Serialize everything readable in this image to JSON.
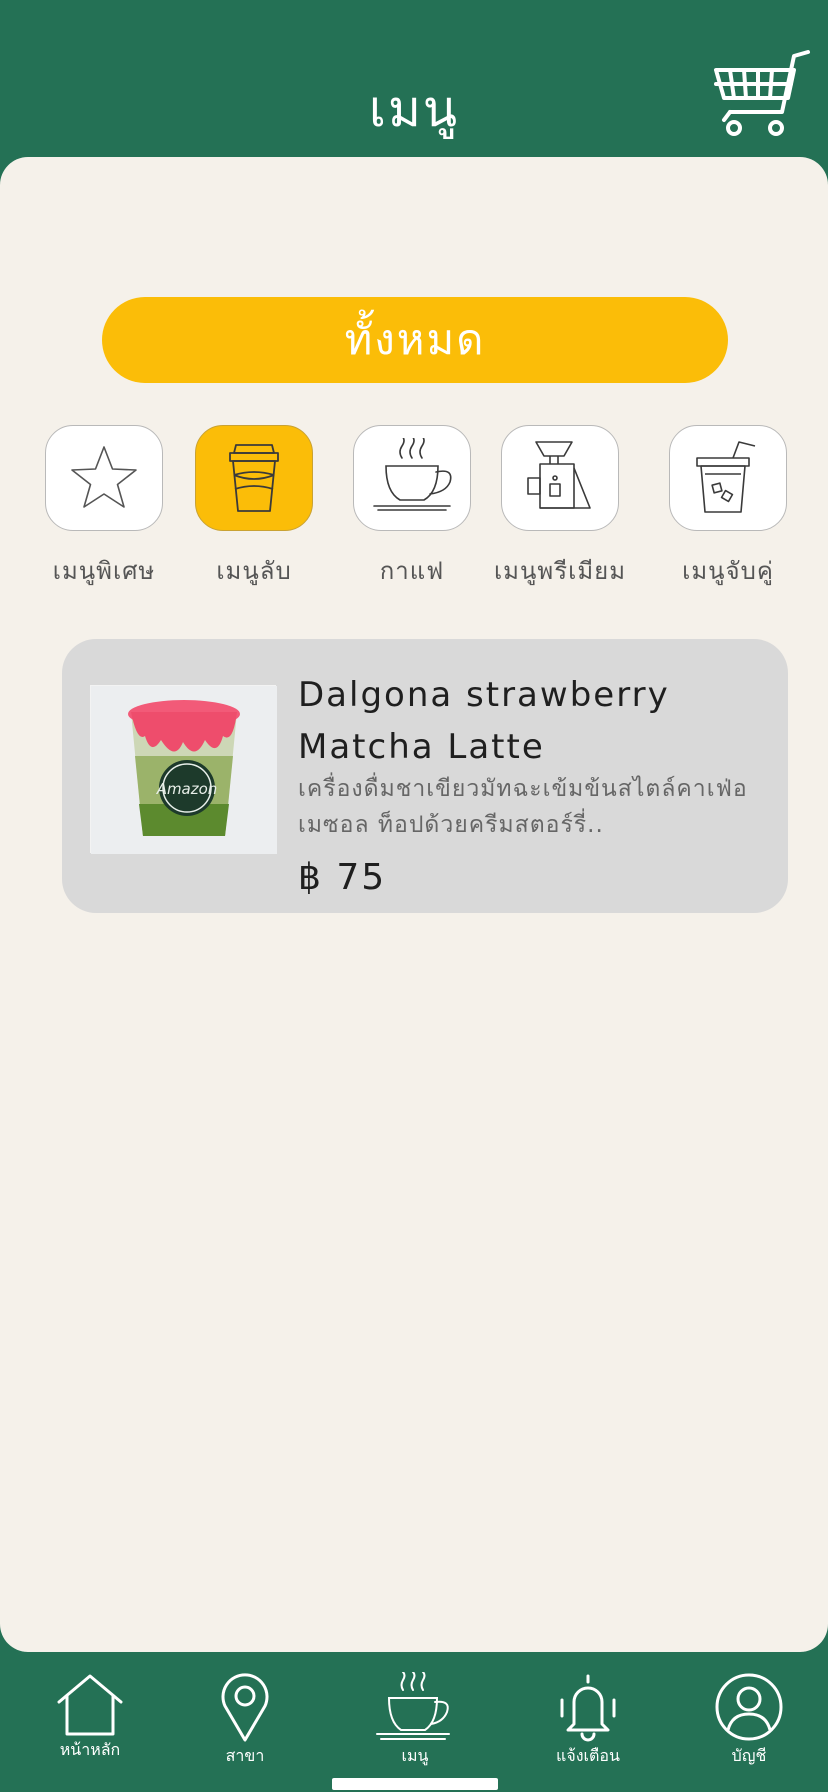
{
  "header": {
    "title": "เมนู"
  },
  "filter": {
    "label": "ทั้งหมด"
  },
  "categories": [
    {
      "label": "เมนูพิเศษ",
      "icon": "star-icon",
      "active": false
    },
    {
      "label": "เมนูลับ",
      "icon": "takeaway-cup-icon",
      "active": true
    },
    {
      "label": "กาแฟ",
      "icon": "coffee-cup-icon",
      "active": false
    },
    {
      "label": "เมนูพรีเมียม",
      "icon": "pour-over-icon",
      "active": false
    },
    {
      "label": "เมนูจับคู่",
      "icon": "iced-drink-icon",
      "active": false
    }
  ],
  "items": [
    {
      "name": "Dalgona strawberry Matcha Latte",
      "description": "เครื่องดื่มชาเขียวมัทฉะเข้มข้นสไตล์คาเฟ่อเมซอล ท็อปด้วยครีมสตอร์รี่..",
      "price": "฿ 75",
      "image_text": "Amazon"
    }
  ],
  "tabs": [
    {
      "label": "หน้าหลัก",
      "icon": "home-icon"
    },
    {
      "label": "สาขา",
      "icon": "location-pin-icon"
    },
    {
      "label": "เมนู",
      "icon": "coffee-cup-icon"
    },
    {
      "label": "แจ้งเตือน",
      "icon": "bell-icon"
    },
    {
      "label": "บัญชี",
      "icon": "user-icon"
    }
  ],
  "colors": {
    "green": "#247155",
    "accent": "#fbbd08",
    "background": "#f5f1ea",
    "card": "#d9d9d9"
  }
}
